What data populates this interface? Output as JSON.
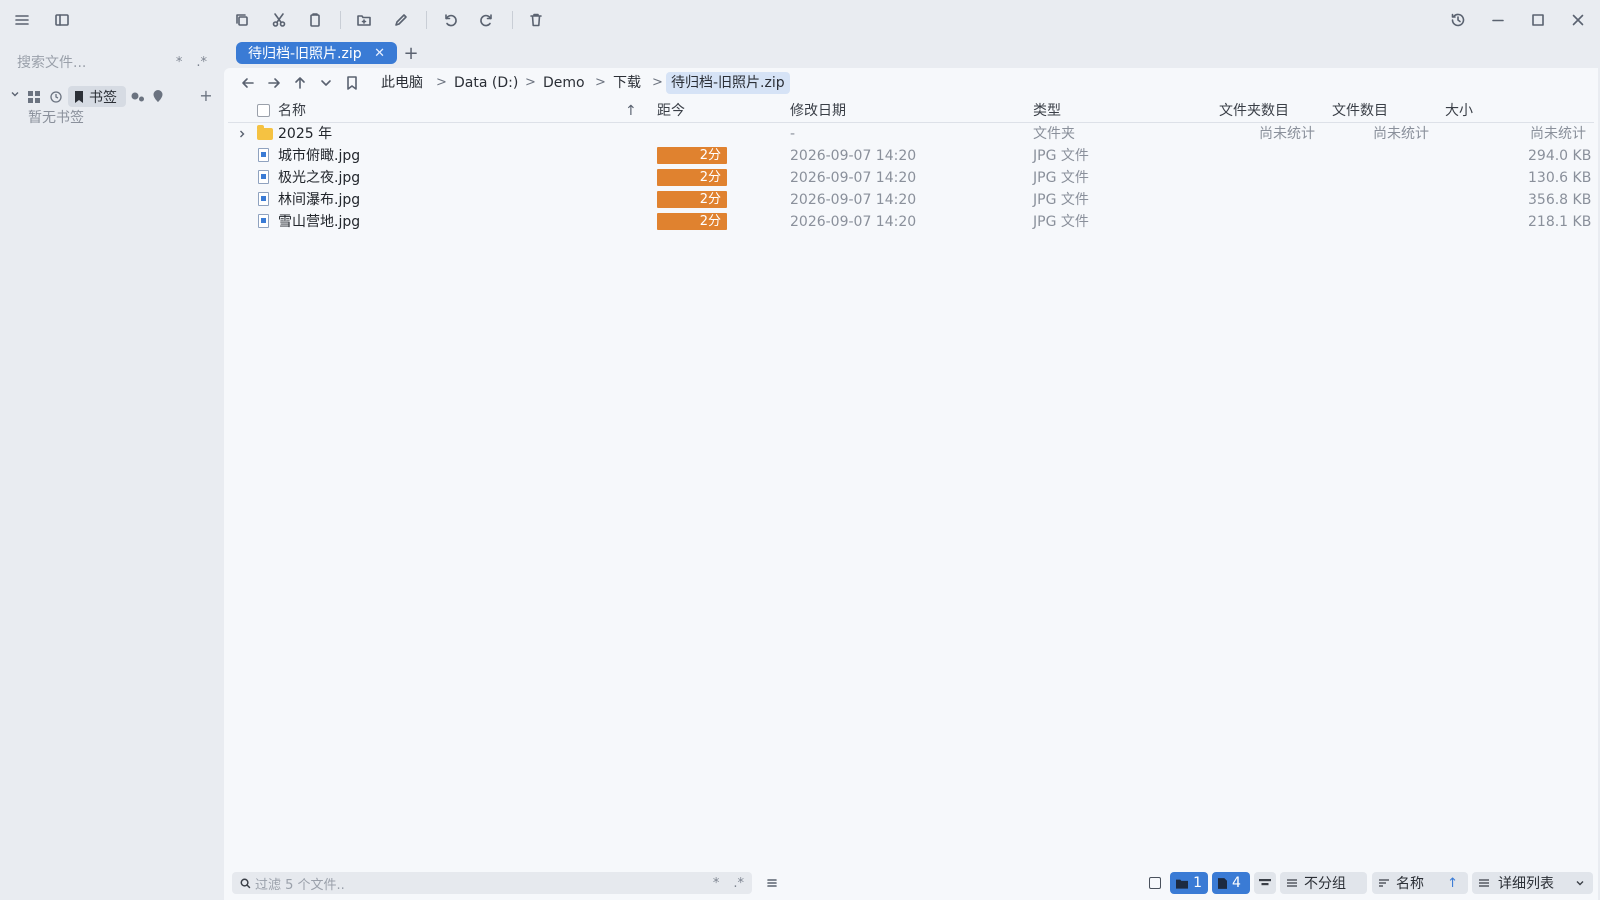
{
  "toolbar": {
    "icons": [
      "menu-icon",
      "sidebar-toggle-icon",
      "copy-icon",
      "cut-icon",
      "paste-icon",
      "new-folder-icon",
      "rename-icon",
      "undo-icon",
      "redo-icon",
      "delete-icon",
      "history-icon",
      "minimize-icon",
      "maximize-icon",
      "close-icon"
    ]
  },
  "sidebar": {
    "search_placeholder": "搜索文件...",
    "search_opt1": "*",
    "search_opt2": ".*",
    "bookmarks_label": "书签",
    "empty_text": "暂无书签",
    "add_label": "+"
  },
  "tab": {
    "label": "待归档-旧照片.zip",
    "close": "✕",
    "add": "+"
  },
  "breadcrumb": {
    "items": [
      "此电脑",
      "Data (D:)",
      "Demo",
      "下载",
      "待归档-旧照片.zip"
    ],
    "sep": ">"
  },
  "columns": {
    "name": "名称",
    "sort_arrow": "↑",
    "age": "距今",
    "modified": "修改日期",
    "type": "类型",
    "folder_count": "文件夹数目",
    "file_count": "文件数目",
    "size": "大小"
  },
  "rows": [
    {
      "name": "2025 年",
      "kind": "folder",
      "age": "",
      "modified": "-",
      "type": "文件夹",
      "folder_count": "尚未统计",
      "file_count": "尚未统计",
      "size": "尚未统计"
    },
    {
      "name": "城市俯瞰.jpg",
      "kind": "file",
      "age": "2分",
      "modified": "2026-09-07 14:20",
      "type": "JPG 文件",
      "folder_count": "",
      "file_count": "",
      "size": "294.0 KB"
    },
    {
      "name": "极光之夜.jpg",
      "kind": "file",
      "age": "2分",
      "modified": "2026-09-07 14:20",
      "type": "JPG 文件",
      "folder_count": "",
      "file_count": "",
      "size": "130.6 KB"
    },
    {
      "name": "林间瀑布.jpg",
      "kind": "file",
      "age": "2分",
      "modified": "2026-09-07 14:20",
      "type": "JPG 文件",
      "folder_count": "",
      "file_count": "",
      "size": "356.8 KB"
    },
    {
      "name": "雪山营地.jpg",
      "kind": "file",
      "age": "2分",
      "modified": "2026-09-07 14:20",
      "type": "JPG 文件",
      "folder_count": "",
      "file_count": "",
      "size": "218.1 KB"
    }
  ],
  "status": {
    "filter_placeholder": "过滤 5 个文件..",
    "filter_opt1": "*",
    "filter_opt2": ".*",
    "folder_count": "1",
    "file_count": "4",
    "group_label": "不分组",
    "sort_label": "名称",
    "sort_dir": "↑",
    "view_label": "详细列表",
    "accent": "#3a7bd5",
    "age_badge_color": "#e0822f"
  }
}
